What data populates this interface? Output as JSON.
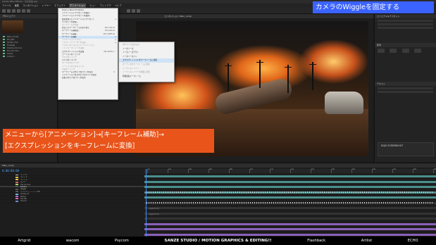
{
  "window": {
    "title": "Adobe After Effects - 炎の演出.aep"
  },
  "menubar": {
    "items": [
      "ファイル",
      "編集",
      "コンポジション",
      "レイヤー",
      "エフェクト",
      "アニメーション",
      "ビュー",
      "ウィンドウ",
      "ヘルプ"
    ],
    "active_index": 5
  },
  "project_panel": {
    "tab": "プロジェクト",
    "items": [
      "Main_Comp",
      "Fire_BG",
      "Tanker_Fire",
      "Footage",
      "Smoke_01.mov",
      "Fire_02.mov",
      "Solids",
      "Comp 1"
    ]
  },
  "viewer": {
    "tab": "コンポジション Main_comp"
  },
  "animation_menu": {
    "items": [
      {
        "label": "Track in Boris FX Mocha",
        "dim": false,
        "submenu": false,
        "shortcut": ""
      },
      {
        "label": "アニメーションプリセットを保存...",
        "dim": false,
        "submenu": false,
        "shortcut": ""
      },
      {
        "label": "アニメーションプリセットを適用...",
        "dim": false,
        "submenu": false,
        "shortcut": ""
      },
      {
        "label": "最近使用したアニメーションプリセット",
        "dim": false,
        "submenu": true,
        "shortcut": ""
      },
      {
        "label": "プリセットを参照...",
        "dim": false,
        "submenu": false,
        "shortcut": ""
      },
      {
        "label": "キーフレームを追加",
        "dim": true,
        "submenu": false,
        "shortcut": ""
      },
      {
        "label": "停止したキーフレームに切り替え",
        "dim": false,
        "submenu": false,
        "shortcut": "Ctrl+Alt+H"
      },
      {
        "label": "キーフレーム補間法...",
        "dim": false,
        "submenu": false,
        "shortcut": "Ctrl+Alt+K"
      },
      {
        "label": "キーフレーム速度...",
        "dim": false,
        "submenu": false,
        "shortcut": "Ctrl+Shift+K"
      },
      {
        "label": "キーフレーム補助",
        "dim": false,
        "submenu": true,
        "shortcut": ""
      },
      {
        "label": "アニメーションテキスト",
        "dim": true,
        "submenu": true,
        "shortcut": ""
      },
      {
        "label": "テキストアニメーターを追加",
        "dim": true,
        "submenu": true,
        "shortcut": ""
      },
      {
        "label": "テキストをパスに沿ってアニメーション",
        "dim": true,
        "submenu": false,
        "shortcut": ""
      },
      {
        "label": "トラッカーポイントを追加",
        "dim": true,
        "submenu": false,
        "shortcut": ""
      },
      {
        "label": "エクスプレッションを追加",
        "dim": false,
        "submenu": false,
        "shortcut": "Alt+Shift+="
      },
      {
        "label": "モーションをトラック",
        "dim": false,
        "submenu": false,
        "shortcut": ""
      },
      {
        "label": "マスクをトラック",
        "dim": true,
        "submenu": false,
        "shortcut": ""
      },
      {
        "label": "カメラをトラック",
        "dim": false,
        "submenu": false,
        "shortcut": ""
      },
      {
        "label": "ワープスタビライザー",
        "dim": true,
        "submenu": false,
        "shortcut": ""
      },
      {
        "label": "モーションをスタビライズ",
        "dim": true,
        "submenu": false,
        "shortcut": ""
      },
      {
        "label": "平面をトラック",
        "dim": true,
        "submenu": false,
        "shortcut": ""
      },
      {
        "label": "キーフレームされたプロパティを表示",
        "dim": false,
        "submenu": false,
        "shortcut": "U"
      },
      {
        "label": "アニメーション化されたプロパティを表示",
        "dim": false,
        "submenu": false,
        "shortcut": ""
      },
      {
        "label": "変更されたプロパティを表示",
        "dim": false,
        "submenu": false,
        "shortcut": ""
      }
    ]
  },
  "keyframe_assistant_submenu": {
    "items": [
      {
        "label": "RPF カメラ読み込み",
        "dim": true,
        "highlight": false
      },
      {
        "label": "イーズイーズ",
        "dim": false,
        "highlight": false
      },
      {
        "label": "イーズイーズアウト",
        "dim": false,
        "highlight": false
      },
      {
        "label": "イーズイーズイン",
        "dim": false,
        "highlight": false
      },
      {
        "label": "エクスプレッションをキーフレームに変換",
        "dim": false,
        "highlight": true
      },
      {
        "label": "オーディオをキーフレームに変換",
        "dim": true,
        "highlight": false
      },
      {
        "label": "シーケンスレイヤー...",
        "dim": true,
        "highlight": false
      },
      {
        "label": "シーケンスレイヤーを順番に配置",
        "dim": true,
        "highlight": false
      },
      {
        "label": "時間反転キーフレーム",
        "dim": false,
        "highlight": false
      }
    ]
  },
  "right_panel": {
    "tab": "エフェクト&プリセット",
    "section1": "整列",
    "section2": "テキスト",
    "dojo_title": "DOJO SCREENSHOT"
  },
  "timeline": {
    "tab": "Main_comp",
    "timecode": "0:00:00:00",
    "ruler_labels": [
      "0s",
      "02s",
      "04s",
      "06s",
      "08s",
      "10s",
      "12s",
      "14s",
      "16s",
      "18s",
      "20s",
      "22s",
      "24s",
      "26s",
      "28s"
    ],
    "layers": [
      {
        "label": "カメラ 1",
        "color": "#c9c9c9",
        "selected": false
      },
      {
        "label": "ライト 1",
        "color": "#e6c44d",
        "selected": false
      },
      {
        "label": "ライト 2",
        "color": "#e6c44d",
        "selected": false
      },
      {
        "label": "ヌル 1",
        "color": "#d46a6a",
        "selected": false
      },
      {
        "label": "Fire_01.mov",
        "color": "#a6d46a",
        "selected": false
      },
      {
        "label": "Position",
        "color": "#555555",
        "selected": true
      },
      {
        "label": "Wiggle",
        "color": "#555555",
        "selected": false
      },
      {
        "label": "エクスプレッション: 位置",
        "color": "#555555",
        "selected": false
      },
      {
        "label": "Smoke_01",
        "color": "#6ab6d4",
        "selected": false
      },
      {
        "label": "Tanker",
        "color": "#b06ad4",
        "selected": false
      },
      {
        "label": "Fire_BG",
        "color": "#d46ab0",
        "selected": false
      },
      {
        "label": "Ground",
        "color": "#6a8ed4",
        "selected": false
      }
    ],
    "graph_labels": [
      "wiggle(5,30)",
      "wiggle(2,10)"
    ]
  },
  "captions": {
    "top": "カメラのWiggleを固定する",
    "main_line1": "メニューから[アニメーション]→[キーフレーム補助]→",
    "main_line2": "[エクスプレッションをキーフレームに変換]"
  },
  "sponsors": [
    "Artgrid",
    "wacom",
    "Psycom",
    "SANZE STUDIO / MOTION GRAPHICS & EDITING!!",
    "Flashback",
    "Artlist",
    "ECHO"
  ],
  "colors": {
    "caption_top_bg": "#3b63ff",
    "caption_main_bg": "#e8541a",
    "menu_highlight": "#cfe3f7",
    "timecode": "#4aa3ff",
    "track_purple": "#8b5fb8",
    "track_teal": "#4b8f8c"
  }
}
